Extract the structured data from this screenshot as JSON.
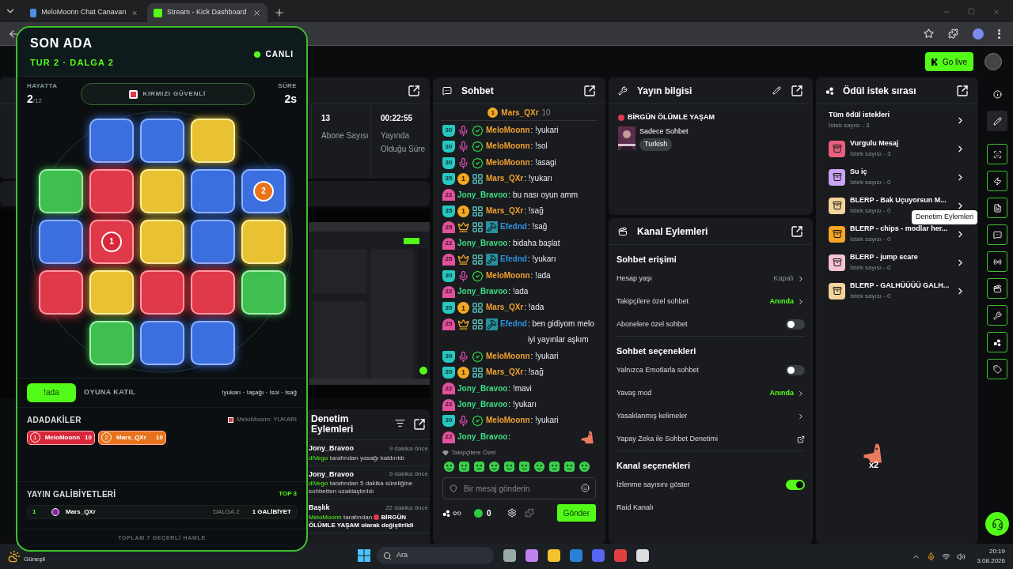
{
  "browser": {
    "tabs": [
      {
        "title": "MeloMoonn Chat Canavarı",
        "selected": false
      },
      {
        "title": "Stream - Kick Dashboard",
        "selected": true
      }
    ]
  },
  "topbar": {
    "go_live": "Go live"
  },
  "stats": [
    {
      "value": "13",
      "label": "Abone Sayısı"
    },
    {
      "value": "00:22:55",
      "label": "Yayında Olduğu Süre"
    }
  ],
  "moderation": {
    "title": "Denetim Eylemleri",
    "entries": [
      {
        "user": "Jony_Bravoo",
        "time": "9 dakika önce",
        "actor": "diVego",
        "action": "tarafından yasağı kaldırıldı",
        "dot": false
      },
      {
        "user": "Jony_Bravoo",
        "time": "9 dakika önce",
        "actor": "diVego",
        "action": "tarafından 5 dakika süreliğine sohbetten uzaklaştırıldı",
        "dot": false
      },
      {
        "user": "Başlık",
        "time": "22 dakika önce",
        "actor": "MeloMoonn",
        "action": "tarafından",
        "dot": true,
        "rest": "BİRGÜN ÖLÜMLE YAŞAM olarak değiştirildi"
      }
    ]
  },
  "chat": {
    "title": "Sohbet",
    "pinned": {
      "badge": "1",
      "user": "Mars_QXr",
      "count": "10"
    },
    "messages": [
      {
        "user": "MeloMoonn",
        "color": "#f0a030",
        "badges": [
          {
            "kind": "shield",
            "text": "30"
          },
          {
            "kind": "mic"
          },
          {
            "kind": "verified"
          }
        ],
        "text": ": !yukari"
      },
      {
        "user": "MeloMoonn",
        "color": "#f0a030",
        "badges": [
          {
            "kind": "shield",
            "text": "30"
          },
          {
            "kind": "mic"
          },
          {
            "kind": "verified"
          }
        ],
        "text": ": !sol"
      },
      {
        "user": "MeloMoonn",
        "color": "#f0a030",
        "badges": [
          {
            "kind": "shield",
            "text": "30"
          },
          {
            "kind": "mic"
          },
          {
            "kind": "verified"
          }
        ],
        "text": ": !asagi"
      },
      {
        "user": "Mars_QXr",
        "color": "#f0a030",
        "badges": [
          {
            "kind": "shield",
            "text": "35"
          },
          {
            "kind": "coin",
            "text": "1"
          },
          {
            "kind": "og"
          }
        ],
        "text": ": !yukarı"
      },
      {
        "user": "Jony_Bravoo",
        "color": "#3ddc84",
        "badges": [
          {
            "kind": "drop",
            "text": "22"
          }
        ],
        "text": ": bu nası oyun amm"
      },
      {
        "user": "Mars_QXr",
        "color": "#f0a030",
        "badges": [
          {
            "kind": "shield",
            "text": "35"
          },
          {
            "kind": "coin",
            "text": "1"
          },
          {
            "kind": "og"
          }
        ],
        "text": ": !sağ"
      },
      {
        "user": "Efednd",
        "color": "#2f8fd8",
        "badges": [
          {
            "kind": "drop",
            "text": "25"
          },
          {
            "kind": "crown"
          },
          {
            "kind": "og"
          },
          {
            "kind": "mod"
          }
        ],
        "text": ": !sağ"
      },
      {
        "user": "Jony_Bravoo",
        "color": "#3ddc84",
        "badges": [
          {
            "kind": "drop",
            "text": "22"
          }
        ],
        "text": ": bidaha başlat"
      },
      {
        "user": "Efednd",
        "color": "#2f8fd8",
        "badges": [
          {
            "kind": "drop",
            "text": "25"
          },
          {
            "kind": "crown"
          },
          {
            "kind": "og"
          },
          {
            "kind": "mod"
          }
        ],
        "text": ": !yukarı"
      },
      {
        "user": "MeloMoonn",
        "color": "#f0a030",
        "badges": [
          {
            "kind": "shield",
            "text": "30"
          },
          {
            "kind": "mic"
          },
          {
            "kind": "verified"
          }
        ],
        "text": ": !ada"
      },
      {
        "user": "Jony_Bravoo",
        "color": "#3ddc84",
        "badges": [
          {
            "kind": "drop",
            "text": "22"
          }
        ],
        "text": ": !ada"
      },
      {
        "user": "Mars_QXr",
        "color": "#f0a030",
        "badges": [
          {
            "kind": "shield",
            "text": "35"
          },
          {
            "kind": "coin",
            "text": "1"
          },
          {
            "kind": "og"
          }
        ],
        "text": ": !ada"
      },
      {
        "user": "Efednd",
        "color": "#2f8fd8",
        "badges": [
          {
            "kind": "drop",
            "text": "25"
          },
          {
            "kind": "crown"
          },
          {
            "kind": "og"
          },
          {
            "kind": "mod"
          }
        ],
        "text": ": ben gidiyom melo iyi yayınlar aşkım"
      },
      {
        "user": "MeloMoonn",
        "color": "#f0a030",
        "badges": [
          {
            "kind": "shield",
            "text": "30"
          },
          {
            "kind": "mic"
          },
          {
            "kind": "verified"
          }
        ],
        "text": ": !yukari"
      },
      {
        "user": "Mars_QXr",
        "color": "#f0a030",
        "badges": [
          {
            "kind": "shield",
            "text": "35"
          },
          {
            "kind": "coin",
            "text": "1"
          },
          {
            "kind": "og"
          }
        ],
        "text": ": !sağ"
      },
      {
        "user": "Jony_Bravoo",
        "color": "#3ddc84",
        "badges": [
          {
            "kind": "drop",
            "text": "22"
          }
        ],
        "text": ": !mavi"
      },
      {
        "user": "Jony_Bravoo",
        "color": "#3ddc84",
        "badges": [
          {
            "kind": "drop",
            "text": "22"
          }
        ],
        "text": ": !yukarı"
      },
      {
        "user": "MeloMoonn",
        "color": "#f0a030",
        "badges": [
          {
            "kind": "shield",
            "text": "30"
          },
          {
            "kind": "mic"
          },
          {
            "kind": "verified"
          }
        ],
        "text": ": !yukari"
      },
      {
        "user": "Jony_Bravoo",
        "color": "#3ddc84",
        "badges": [
          {
            "kind": "drop",
            "text": "22"
          }
        ],
        "text": ":",
        "emote": true
      }
    ],
    "followers_only": "Takipçilere Özel",
    "placeholder": "Bir mesaj gönderin",
    "points": "0",
    "send": "Gönder"
  },
  "stream_info": {
    "title": "Yayın bilgisi",
    "stream_title": "BİRGÜN ÖLÜMLE YAŞAM",
    "category": "Sadece Sohbet",
    "language": "Turkish"
  },
  "channel_actions": {
    "title": "Kanal Eylemleri",
    "sections": [
      {
        "title": "Sohbet erişimi",
        "rows": [
          {
            "kind": "link",
            "label": "Hesap yaşı",
            "value": "Kapalı",
            "active": false
          },
          {
            "kind": "link",
            "label": "Takipçilere özel sohbet",
            "value": "Anında",
            "active": true
          },
          {
            "kind": "toggle",
            "label": "Abonelere özel sohbet",
            "on": false
          }
        ]
      },
      {
        "title": "Sohbet seçenekleri",
        "rows": [
          {
            "kind": "toggle",
            "label": "Yalnızca Emotlarla sohbet",
            "on": false
          },
          {
            "kind": "link",
            "label": "Yavaş mod",
            "value": "Anında",
            "active": true
          },
          {
            "kind": "link",
            "label": "Yasaklanmış kelimeler"
          },
          {
            "kind": "external",
            "label": "Yapay Zeka ile Sohbet Denetimi"
          }
        ]
      },
      {
        "title": "Kanal seçenekleri",
        "rows": [
          {
            "kind": "toggle",
            "label": "İzlenme sayısını göster",
            "on": true
          },
          {
            "kind": "plain",
            "label": "Raid Kanalı"
          }
        ]
      }
    ]
  },
  "rewards": {
    "title": "Ödül istek sırası",
    "all": {
      "title": "Tüm ödül istekleri",
      "count": "İstek sayısı - 3"
    },
    "items": [
      {
        "title": "Vurgulu Mesaj",
        "count": "İstek sayısı - 3",
        "color": "#e8607e"
      },
      {
        "title": "Su iç",
        "count": "İstek sayısı - 0",
        "color": "#c9a3f5"
      },
      {
        "title": "BLERP - Bak Uçuyorsun M...",
        "count": "İstek sayısı - 0",
        "color": "#f3d49a"
      },
      {
        "title": "BLERP - chips - modlar her...",
        "count": "İstek sayısı - 0",
        "color": "#f5a524"
      },
      {
        "title": "BLERP - jump scare",
        "count": "İstek sayısı - 0",
        "color": "#f6c3d2"
      },
      {
        "title": "BLERP - GALHÜÜÜÜ GALH...",
        "count": "İstek sayısı - 0",
        "color": "#f3d49a"
      }
    ]
  },
  "toolbar": [
    {
      "kind": "info"
    },
    {
      "kind": "edit"
    },
    {
      "kind": "scan"
    },
    {
      "kind": "bolt"
    },
    {
      "kind": "doc"
    },
    {
      "kind": "chat"
    },
    {
      "kind": "broadcast"
    },
    {
      "kind": "video"
    },
    {
      "kind": "wrench"
    },
    {
      "kind": "dots"
    },
    {
      "kind": "tag"
    }
  ],
  "tooltip": "Denetim Eylemleri",
  "emote_overlay": {
    "count": "x2"
  },
  "game": {
    "title": "SON ADA",
    "subtitle": "TUR 2 · DALGA 2",
    "status": "CANLI",
    "alive_label": "HAYATTA",
    "alive": "2",
    "alive_total": "/12",
    "safe": "KIRMIZI GÜVENLİ",
    "time_label": "SÜRE",
    "time": "2s",
    "tiles": [
      [
        {
          "kind": "empty"
        },
        {
          "kind": "blue"
        },
        {
          "kind": "blue"
        },
        {
          "kind": "yellow"
        },
        {
          "kind": "empty"
        }
      ],
      [
        {
          "kind": "green"
        },
        {
          "kind": "red"
        },
        {
          "kind": "yellow"
        },
        {
          "kind": "blue"
        },
        {
          "kind": "blue",
          "marker": {
            "text": "2",
            "color": "#e8731a"
          }
        }
      ],
      [
        {
          "kind": "blue"
        },
        {
          "kind": "red",
          "marker": {
            "text": "1",
            "color": "#d7283a"
          }
        },
        {
          "kind": "yellow"
        },
        {
          "kind": "blue"
        },
        {
          "kind": "yellow"
        }
      ],
      [
        {
          "kind": "red"
        },
        {
          "kind": "yellow"
        },
        {
          "kind": "red"
        },
        {
          "kind": "red"
        },
        {
          "kind": "green"
        }
      ],
      [
        {
          "kind": "empty"
        },
        {
          "kind": "green"
        },
        {
          "kind": "blue"
        },
        {
          "kind": "blue"
        },
        {
          "kind": "empty"
        }
      ]
    ],
    "action_button": "!ada",
    "join": "OYUNA KATIL",
    "commands": "!yukarı · !aşağı · !sol · !sağ",
    "players_title": "ADADAKİLER",
    "last_move": "MeloMoonn: YUKARI",
    "players": [
      {
        "rank": "1",
        "name": "MeloMoonn",
        "score": "10",
        "color": "#d7283a"
      },
      {
        "rank": "2",
        "name": "Mars_QXr",
        "score": "10",
        "color": "#e8731a"
      }
    ],
    "wins_title": "YAYIN GALİBİYETLERİ",
    "wins_badge": "TOP 3",
    "wins": [
      {
        "rank": "1",
        "name": "Mars_QXr",
        "wave": "DALGA 2",
        "wins": "1 GALİBİYET",
        "color": "#8e24aa"
      }
    ],
    "footer": "TOPLAM 7 GEÇERLİ HAMLE"
  },
  "taskbar": {
    "weather": "Güneşli",
    "search": "Ara",
    "time": "20:19",
    "date": "3.08.2026"
  }
}
